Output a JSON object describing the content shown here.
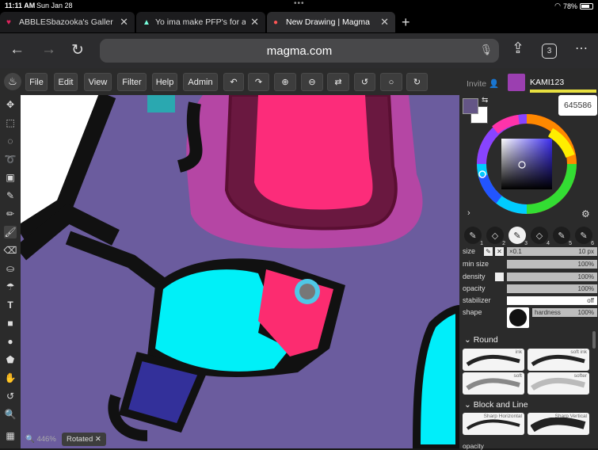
{
  "status": {
    "time": "11:11 AM",
    "date": "Sun Jan 28",
    "battery": "78%",
    "dots": "•••"
  },
  "tabs": [
    {
      "title": "ABBLESbazooka's Galler",
      "icon": "heart-icon",
      "active": false
    },
    {
      "title": "Yo ima make PFP's for an",
      "icon": "triangle-icon",
      "active": false
    },
    {
      "title": "New Drawing | Magma",
      "icon": "magma-icon",
      "active": true
    }
  ],
  "url": "magma.com",
  "tab_count": "3",
  "menu": {
    "file": "File",
    "edit": "Edit",
    "view": "View",
    "filter": "Filter",
    "help": "Help",
    "admin": "Admin"
  },
  "user": {
    "invite": "Invite",
    "name": "KAMI123"
  },
  "color": {
    "hex": "645586",
    "primary": "#645586",
    "secondary": "#ffffff"
  },
  "brushes": {
    "slots": [
      "1",
      "2",
      "3",
      "4",
      "5",
      "6"
    ],
    "active_slot": "3"
  },
  "props": {
    "size_label": "size",
    "size_mult": "×0.1",
    "size_value": "10 px",
    "min_size_label": "min size",
    "min_size_value": "100%",
    "density_label": "density",
    "density_value": "100%",
    "opacity_label": "opacity",
    "opacity_value": "100%",
    "stabilizer_label": "stabilizer",
    "stabilizer_value": "off",
    "shape_label": "shape",
    "hardness_label": "hardness",
    "hardness_value": "100%"
  },
  "brush_sets": {
    "round_title": "Round",
    "round_items": [
      "ink",
      "soft ink",
      "soft",
      "softer"
    ],
    "block_title": "Block and Line",
    "block_items": [
      "Sharp Horizontal",
      "Sharp Vertical"
    ],
    "cut_label": "opacity"
  },
  "canvas": {
    "zoom": "446%",
    "rotated": "Rotated"
  }
}
